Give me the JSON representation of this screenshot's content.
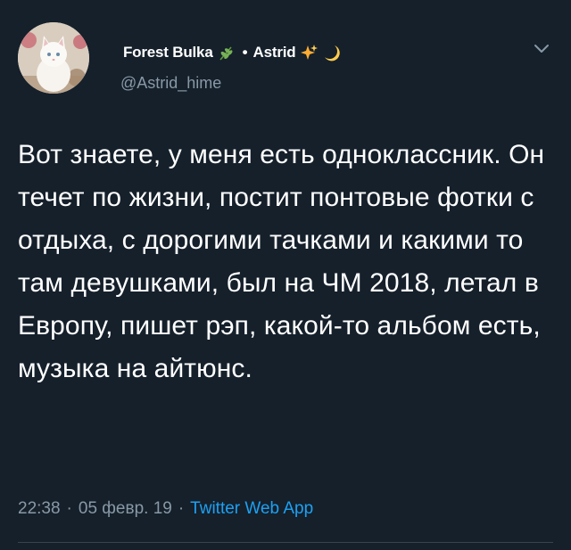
{
  "tweet": {
    "display_name": "Forest Bulka",
    "separator": "•",
    "second_name": "Astrid",
    "handle": "@Astrid_hime",
    "text": "Вот знаете, у меня есть одноклассник. Он течет по жизни, постит понтовые фотки с отдыха, с дорогими тачками и какими то там девушками, был на ЧМ 2018, летал в Европу, пишет рэп, какой-то альбом есть, музыка на айтюнс.",
    "time": "22:38",
    "dot": "·",
    "date": "05 февр. 19",
    "source": "Twitter Web App"
  },
  "icons": {
    "name_emoji_1": "herb-icon",
    "name_emoji_2": "sparkles-icon",
    "name_emoji_3": "crescent-moon-icon",
    "menu": "chevron-down-icon",
    "avatar": "white-cat-photo"
  },
  "colors": {
    "background": "#15202b",
    "text_primary": "#ffffff",
    "text_secondary": "#8899a6",
    "link": "#1da1f2",
    "divider": "#38444d"
  }
}
